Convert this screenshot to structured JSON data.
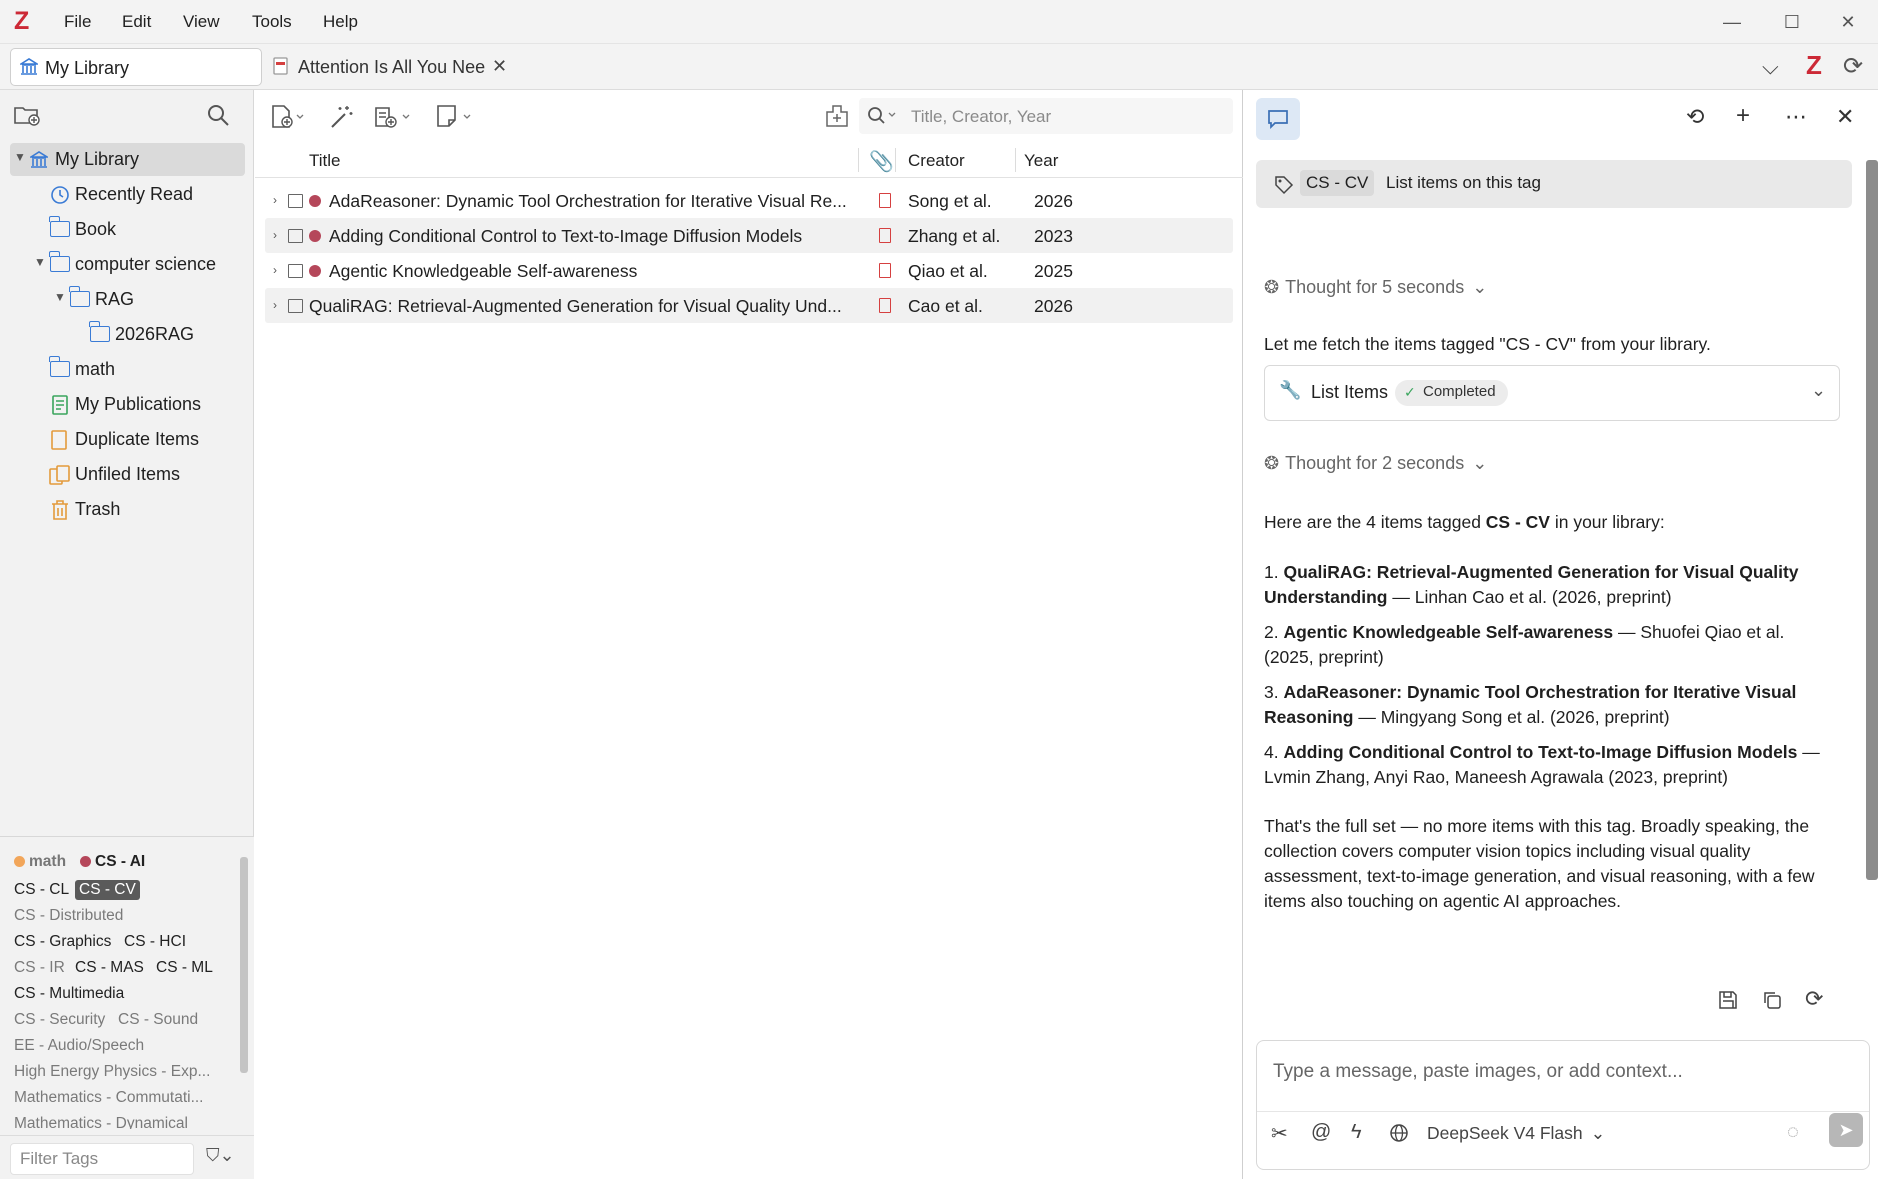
{
  "menubar": {
    "logo": "Z",
    "items": [
      "File",
      "Edit",
      "View",
      "Tools",
      "Help"
    ]
  },
  "tabs": {
    "library": "My Library",
    "document": "Attention Is All You Nee"
  },
  "collections": {
    "my_library": "My Library",
    "recently_read": "Recently Read",
    "book": "Book",
    "computer_science": "computer science",
    "rag": "RAG",
    "rag2026": "2026RAG",
    "math": "math",
    "my_publications": "My Publications",
    "duplicate_items": "Duplicate Items",
    "unfiled_items": "Unfiled Items",
    "trash": "Trash"
  },
  "tags": {
    "colored": [
      {
        "label": "math",
        "color": "#f2a65a"
      },
      {
        "label": "CS - AI",
        "color": "#b5475a"
      }
    ],
    "cs_cl": "CS - CL",
    "cs_cv": "CS - CV",
    "cs_distributed": "CS - Distributed",
    "cs_graphics": "CS - Graphics",
    "cs_hci": "CS - HCI",
    "cs_ir": "CS - IR",
    "cs_mas": "CS - MAS",
    "cs_ml": "CS - ML",
    "cs_multimedia": "CS - Multimedia",
    "cs_security": "CS - Security",
    "cs_sound": "CS - Sound",
    "ee_audio": "EE - Audio/Speech",
    "hep": "High Energy Physics - Exp...",
    "math_comm": "Mathematics - Commutati...",
    "math_dyn": "Mathematics - Dynamical",
    "filter_placeholder": "Filter Tags"
  },
  "items": {
    "search_placeholder": "Title, Creator, Year",
    "columns": {
      "title": "Title",
      "creator": "Creator",
      "year": "Year"
    },
    "rows": [
      {
        "title": "AdaReasoner: Dynamic Tool Orchestration for Iterative Visual Re...",
        "creator": "Song et al.",
        "year": "2026",
        "tag_color": "#b5475a"
      },
      {
        "title": "Adding Conditional Control to Text-to-Image Diffusion Models",
        "creator": "Zhang et al.",
        "year": "2023",
        "tag_color": "#b5475a"
      },
      {
        "title": "Agentic Knowledgeable Self-awareness",
        "creator": "Qiao et al.",
        "year": "2025",
        "tag_color": "#b5475a"
      },
      {
        "title": "QualiRAG: Retrieval-Augmented Generation for Visual Quality Und...",
        "creator": "Cao et al.",
        "year": "2026",
        "tag_color": ""
      }
    ]
  },
  "chat": {
    "context_tag": "CS - CV",
    "context_action": "List items on this tag",
    "thought1": "Thought for 5 seconds",
    "intro": "Let me fetch the items tagged \"CS - CV\" from your library.",
    "tool_name": "List Items",
    "tool_status": "Completed",
    "thought2": "Thought for 2 seconds",
    "answer_lead_pre": "Here are the 4 items tagged ",
    "answer_lead_tag": "CS - CV",
    "answer_lead_post": " in your library:",
    "list": [
      {
        "num": "1. ",
        "title": "QualiRAG: Retrieval-Augmented Generation for Visual Quality Understanding",
        "rest": " — Linhan Cao et al. (2026, preprint)"
      },
      {
        "num": "2. ",
        "title": "Agentic Knowledgeable Self-awareness",
        "rest": " — Shuofei Qiao et al. (2025, preprint)"
      },
      {
        "num": "3. ",
        "title": "AdaReasoner: Dynamic Tool Orchestration for Iterative Visual Reasoning",
        "rest": " — Mingyang Song et al. (2026, preprint)"
      },
      {
        "num": "4. ",
        "title": "Adding Conditional Control to Text-to-Image Diffusion Models",
        "rest": " — Lvmin Zhang, Anyi Rao, Maneesh Agrawala (2023, preprint)"
      }
    ],
    "summary": "That's the full set — no more items with this tag. Broadly speaking, the collection covers computer vision topics including visual quality assessment, text-to-image generation, and visual reasoning, with a few items also touching on agentic AI approaches.",
    "input_placeholder": "Type a message, paste images, or add context...",
    "model": "DeepSeek V4 Flash"
  }
}
